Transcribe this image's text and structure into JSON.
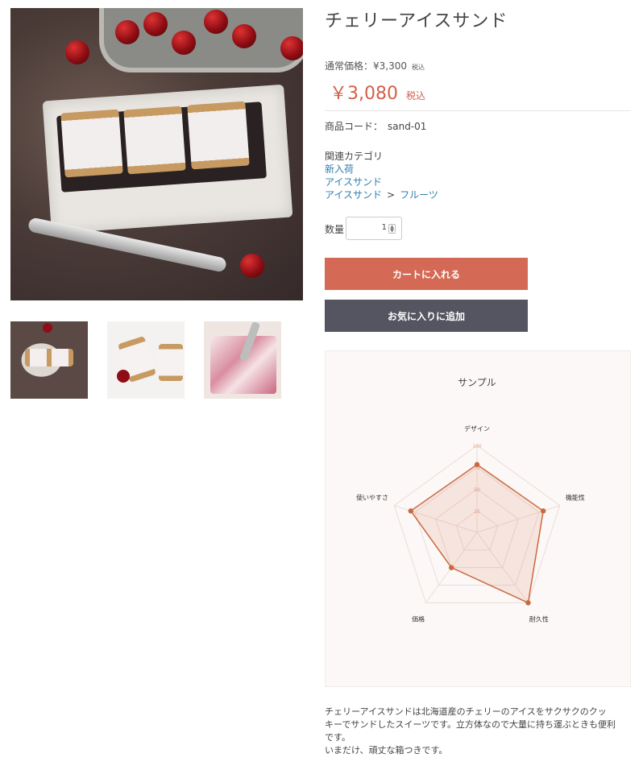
{
  "product": {
    "title": "チェリーアイスサンド",
    "regular_price_label": "通常価格：¥3,300",
    "regular_price_tax": "税込",
    "sale_price": "￥3,080",
    "sale_price_tax": "税込",
    "code_label": "商品コード：",
    "code_value": "sand-01",
    "category_label": "関連カテゴリ",
    "categories": [
      "新入荷",
      "アイスサンド",
      "アイスサンド",
      "フルーツ"
    ],
    "category_separator": ">",
    "quantity_label": "数量",
    "quantity_value": "1",
    "add_to_cart_label": "カートに入れる",
    "favorite_label": "お気に入りに追加",
    "description_lines": [
      "チェリーアイスサンドは北海道産のチェリーのアイスをサクサクのクッ",
      "キーでサンドしたスイーツです。立方体なので大量に持ち運ぶときも便利",
      "です。",
      "いまだけ、頑丈な箱つきです。"
    ]
  },
  "colors": {
    "accent": "#d46a55",
    "price": "#d35f4a",
    "link": "#2f7fb0",
    "dark_button": "#555562",
    "radar_line": "#c8693f"
  },
  "chart_data": {
    "type": "radar",
    "title": "サンプル",
    "axes": [
      "デザイン",
      "機能性",
      "耐久性",
      "価格",
      "使いやすさ"
    ],
    "ticks": [
      "25",
      "50",
      "75",
      "100"
    ],
    "range": [
      0,
      100
    ],
    "series": [
      {
        "values": [
          78,
          80,
          100,
          50,
          80
        ]
      }
    ]
  }
}
